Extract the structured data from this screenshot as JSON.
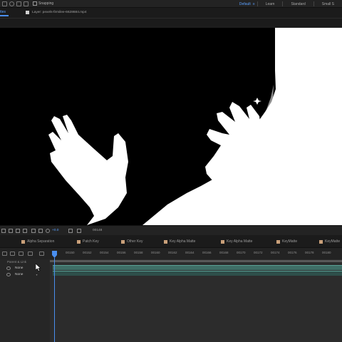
{
  "toolbar": {
    "snapping_label": "Snapping",
    "workspaces": [
      {
        "label": "Default",
        "active": true
      },
      {
        "label": "Learn",
        "active": false
      },
      {
        "label": "Standard",
        "active": false
      },
      {
        "label": "Small S",
        "active": false
      }
    ]
  },
  "panel": {
    "active_tab_label": "ttes",
    "layer_tab_label": "Layer: pexels-firmilee-6628684.mp4"
  },
  "viewer": {
    "background_color": "#000000",
    "matte_color": "#ffffff"
  },
  "viewer_bar": {
    "magnification": "+0.0",
    "timecode": "00148"
  },
  "timeline": {
    "tabs": [
      {
        "label": "Alpha Separation"
      },
      {
        "label": "Patch Key"
      },
      {
        "label": "Other Key"
      },
      {
        "label": "Key Alpha Matte"
      },
      {
        "label": "Key Alpha Matte"
      },
      {
        "label": "KeyMatte"
      },
      {
        "label": "KeyMatte"
      }
    ],
    "ruler_ticks": [
      "00150",
      "00152",
      "00154",
      "00156",
      "00158",
      "00160",
      "00162",
      "00164",
      "00166",
      "00168",
      "00170",
      "00172",
      "00174",
      "00176",
      "00178",
      "00180"
    ],
    "parent_link_label": "Parent & Link",
    "layers": [
      {
        "parent": "None"
      },
      {
        "parent": "None"
      }
    ],
    "playhead_color": "#4a8ff0",
    "track_color": "#3f6e66"
  }
}
